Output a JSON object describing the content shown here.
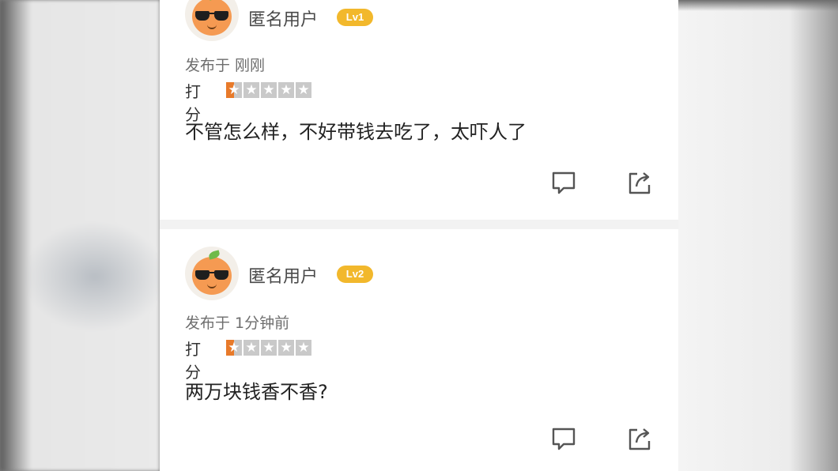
{
  "comments": [
    {
      "username": "匿名用户",
      "level": "Lv1",
      "posted": "发布于 刚刚",
      "rating_label": "打分",
      "rating": 0.5,
      "rating_max": 5,
      "text": "不管怎么样，不好带钱去吃了，太吓人了",
      "icons": [
        "reply-icon",
        "share-icon"
      ]
    },
    {
      "username": "匿名用户",
      "level": "Lv2",
      "posted": "发布于 1分钟前",
      "rating_label": "打分",
      "rating": 0.5,
      "rating_max": 5,
      "text": "两万块钱香不香?",
      "icons": [
        "reply-icon",
        "share-icon"
      ]
    }
  ],
  "colors": {
    "level_badge": "#f2b82c",
    "star_fill": "#e87a2a",
    "star_empty": "#c9c9c9"
  }
}
